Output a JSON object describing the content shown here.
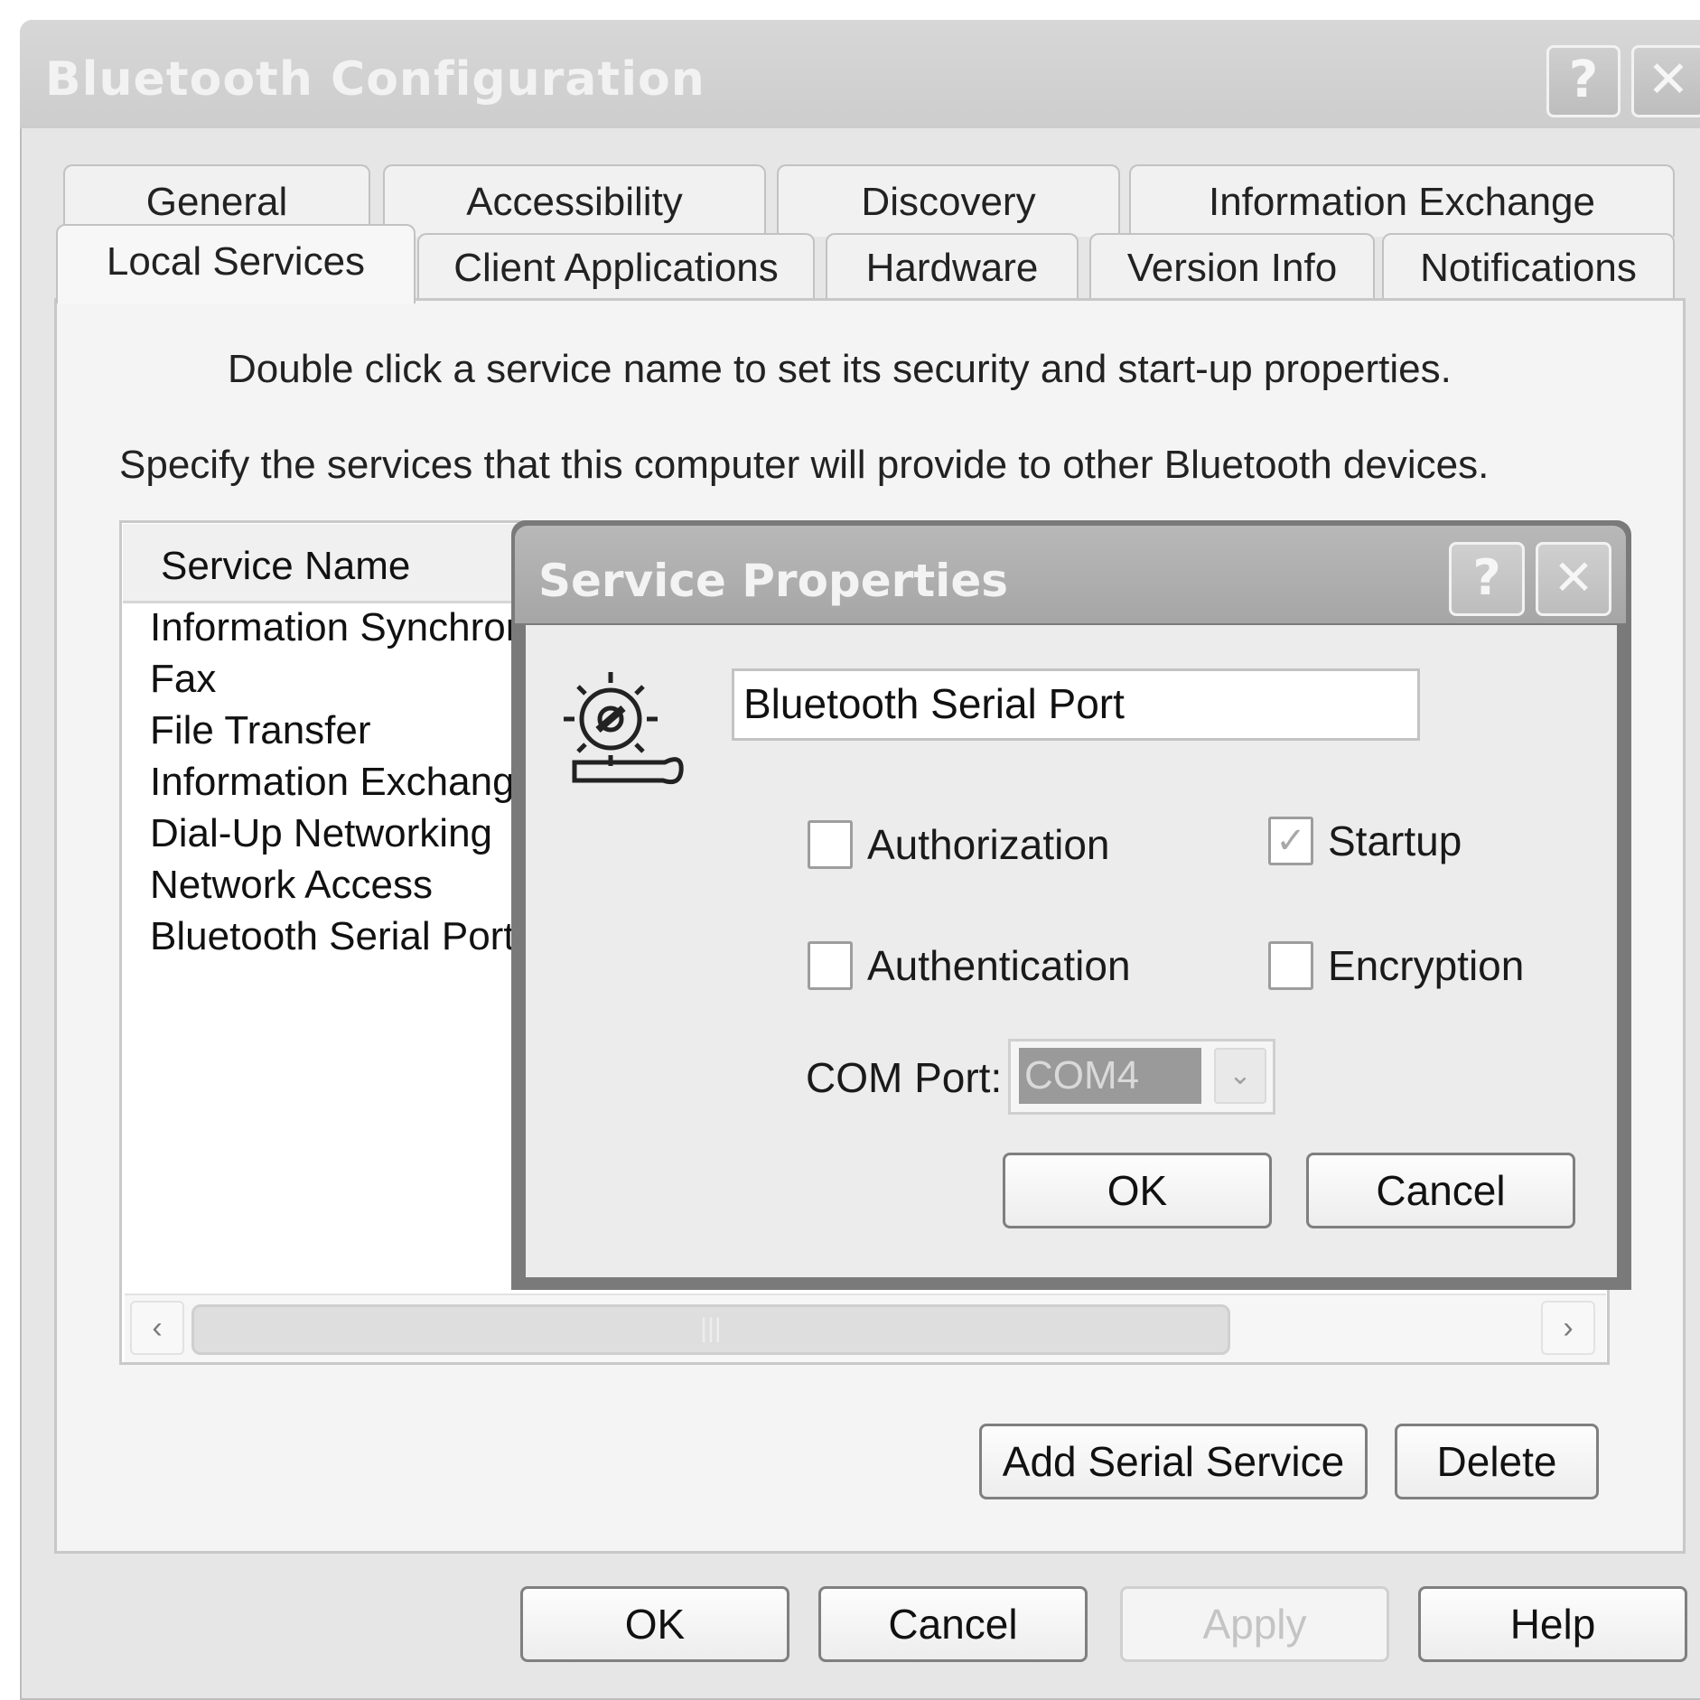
{
  "window": {
    "title": "Bluetooth Configuration",
    "help_button": "?",
    "close_button": "✕"
  },
  "tabs": {
    "row1": [
      "General",
      "Accessibility",
      "Discovery",
      "Information Exchange"
    ],
    "row2": [
      "Local Services",
      "Client Applications",
      "Hardware",
      "Version Info",
      "Notifications"
    ],
    "active": "Local Services"
  },
  "panel": {
    "hint": "Double click a service name to set its security and start-up properties.",
    "description": "Specify the services that this computer will provide to other Bluetooth devices."
  },
  "service_list": {
    "header": "Service Name",
    "items": [
      "Information Synchror",
      "Fax",
      "File Transfer",
      "Information Exchang",
      "Dial-Up Networking",
      "Network Access",
      "Bluetooth Serial Port"
    ],
    "scroll_left": "‹",
    "scroll_right": "›",
    "thumb_grip": "|||"
  },
  "panel_buttons": {
    "add_serial": "Add Serial Service",
    "delete": "Delete"
  },
  "footer_buttons": {
    "ok": "OK",
    "cancel": "Cancel",
    "apply": "Apply",
    "help": "Help"
  },
  "service_properties": {
    "title": "Service Properties",
    "help_button": "?",
    "close_button": "✕",
    "service_name_value": "Bluetooth Serial Port",
    "icon": "gear-wrench-icon",
    "checkboxes": {
      "authorization": {
        "label": "Authorization",
        "checked": false
      },
      "startup": {
        "label": "Startup",
        "checked": true
      },
      "authentication": {
        "label": "Authentication",
        "checked": false
      },
      "encryption": {
        "label": "Encryption",
        "checked": false
      }
    },
    "startup_check_glyph": "✓",
    "com_port_label": "COM Port:",
    "com_port_value": "COM4",
    "com_dropdown_glyph": "⌄",
    "ok": "OK",
    "cancel": "Cancel"
  }
}
